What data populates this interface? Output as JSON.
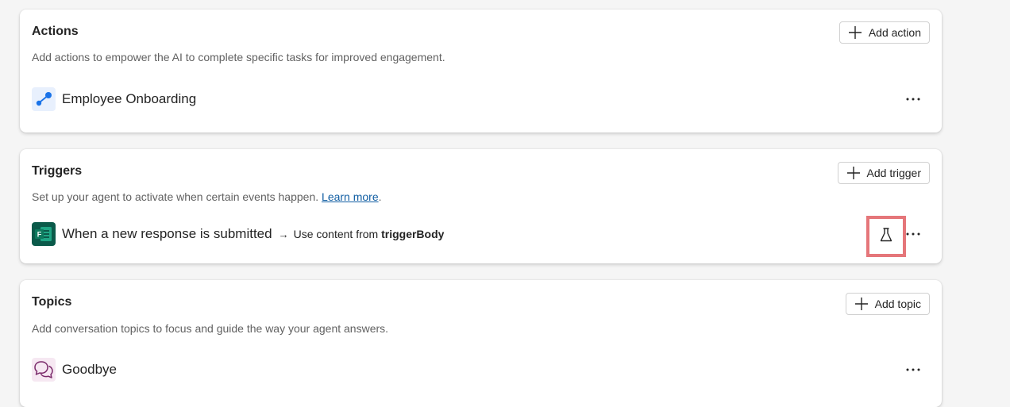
{
  "actions": {
    "title": "Actions",
    "description": "Add actions to empower the AI to complete specific tasks for improved engagement.",
    "add_label": "Add action",
    "items": [
      {
        "label": "Employee Onboarding",
        "icon": "flow-icon"
      }
    ]
  },
  "triggers": {
    "title": "Triggers",
    "description": "Set up your agent to activate when certain events happen.",
    "learn_more": "Learn more",
    "period": ".",
    "add_label": "Add trigger",
    "items": [
      {
        "label": "When a new response is submitted",
        "arrow": "→",
        "use_prefix": "Use content from",
        "use_value": "triggerBody",
        "icon": "forms-icon"
      }
    ]
  },
  "topics": {
    "title": "Topics",
    "description": "Add conversation topics to focus and guide the way your agent answers.",
    "add_label": "Add topic",
    "items": [
      {
        "label": "Goodbye",
        "icon": "chat-bubbles-icon"
      }
    ]
  },
  "colors": {
    "highlight": "#e5767a",
    "link": "#115ea3",
    "flow_blue": "#1a73e8",
    "forms_green": "#0b5a4a",
    "topic_purple": "#7a2a6a"
  }
}
